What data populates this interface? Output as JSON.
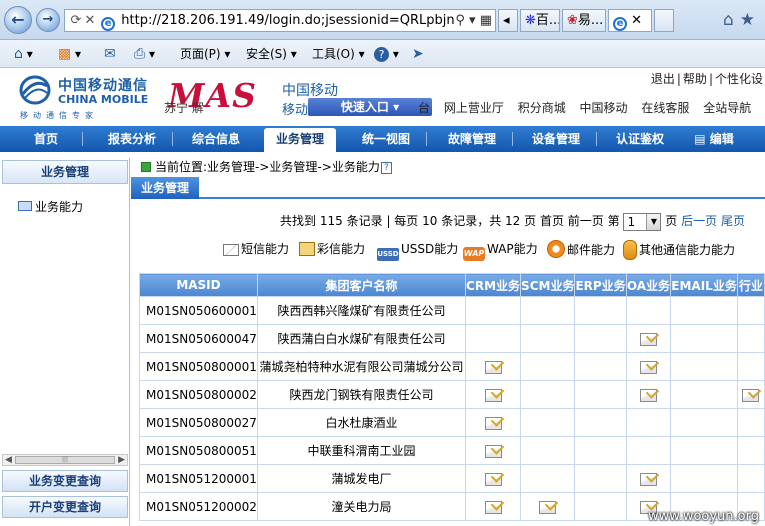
{
  "browser": {
    "url": "http://218.206.191.49/login.do;jsessionid=QRLpbjn",
    "tabs": [
      {
        "label": "百..."
      },
      {
        "label": "易..."
      },
      {
        "label": ""
      }
    ],
    "commands": {
      "page": "页面(P)",
      "safety": "安全(S)",
      "tools": "工具(O)"
    }
  },
  "header": {
    "cm_name_cn": "中国移动通信",
    "cm_name_en": "CHINA MOBILE",
    "cm_slogan": "移动通信专家",
    "mas_logo": "MAS",
    "mas_sub1": "中国移动",
    "mas_sub2": "移动",
    "faded_text": "苏宁 解",
    "quick_entry": "快速入口",
    "top_links": [
      "退出",
      "帮助",
      "个性化设"
    ],
    "site_links": [
      "台",
      "网上营业厅",
      "积分商城",
      "中国移动",
      "在线客服",
      "全站导航"
    ]
  },
  "nav": {
    "items": [
      "首页",
      "报表分析",
      "综合信息",
      "业务管理",
      "统一视图",
      "故障管理",
      "设备管理",
      "认证鉴权",
      "编辑"
    ],
    "active_index": 3
  },
  "sidebar": {
    "title": "业务管理",
    "items": [
      "业务能力"
    ],
    "bottom_buttons": [
      "业务变更查询",
      "开户变更查询"
    ]
  },
  "content": {
    "breadcrumb": "当前位置:业务管理->业务管理->业务能力",
    "section_tab": "业务管理",
    "pager": {
      "found_prefix": "共找到",
      "total": "115",
      "per_page_text": "条记录 | 每页 10 条记录，共 12 页",
      "first": "首页",
      "prev": "前一页",
      "page_label": "第",
      "current": "1",
      "page_unit": "页",
      "next": "后一页",
      "last": "尾页"
    },
    "legend": [
      {
        "icon": "sms-icon",
        "label": "短信能力"
      },
      {
        "icon": "mms-icon",
        "label": "彩信能力"
      },
      {
        "icon": "ussd-icon",
        "label": "USSD能力"
      },
      {
        "icon": "wap-icon",
        "label": "WAP能力"
      },
      {
        "icon": "email-icon",
        "label": "邮件能力"
      },
      {
        "icon": "other-icon",
        "label": "其他通信能力能力"
      }
    ],
    "ussd_icon_text": "USSD",
    "wap_icon_text": "WAP",
    "table": {
      "columns": [
        "MASID",
        "集团客户名称",
        "CRM业务",
        "SCM业务",
        "ERP业务",
        "OA业务",
        "EMAIL业务",
        "行业"
      ],
      "rows": [
        {
          "masid": "M01SN050600001",
          "name": "陕西西韩兴隆煤矿有限责任公司",
          "marks": [
            0,
            0,
            0,
            0,
            0,
            0
          ]
        },
        {
          "masid": "M01SN050600047",
          "name": "陕西蒲白白水煤矿有限责任公司",
          "marks": [
            0,
            0,
            0,
            1,
            0,
            0
          ]
        },
        {
          "masid": "M01SN050800001",
          "name": "蒲城尧柏特种水泥有限公司蒲城分公司",
          "marks": [
            1,
            0,
            0,
            1,
            0,
            0
          ]
        },
        {
          "masid": "M01SN050800002",
          "name": "陕西龙门钢铁有限责任公司",
          "marks": [
            1,
            0,
            0,
            1,
            0,
            1
          ]
        },
        {
          "masid": "M01SN050800027",
          "name": "白水杜康酒业",
          "marks": [
            1,
            0,
            0,
            0,
            0,
            0
          ]
        },
        {
          "masid": "M01SN050800051",
          "name": "中联重科渭南工业园",
          "marks": [
            1,
            0,
            0,
            0,
            0,
            0
          ]
        },
        {
          "masid": "M01SN051200001",
          "name": "蒲城发电厂",
          "marks": [
            1,
            0,
            0,
            1,
            0,
            0
          ]
        },
        {
          "masid": "M01SN051200002",
          "name": "潼关电力局",
          "marks": [
            1,
            1,
            0,
            1,
            0,
            0
          ]
        }
      ]
    }
  },
  "watermark": "www.wooyun.org"
}
